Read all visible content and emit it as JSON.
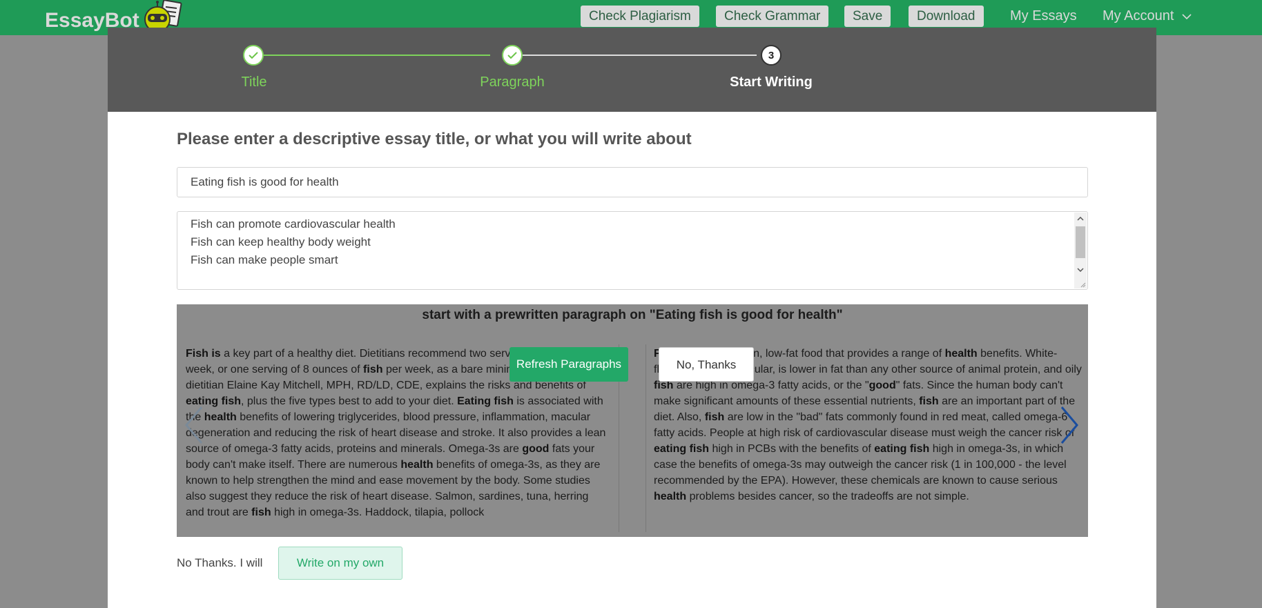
{
  "topbar": {
    "logo_text": "EssayBot",
    "buttons": [
      "Check Plagiarism",
      "Check Grammar",
      "Save",
      "Download"
    ],
    "links": [
      "My Essays",
      "My Account"
    ]
  },
  "stepper": {
    "steps": [
      {
        "label": "Title",
        "state": "done"
      },
      {
        "label": "Paragraph",
        "state": "done"
      },
      {
        "label": "Start Writing",
        "state": "active",
        "number": "3"
      }
    ]
  },
  "form": {
    "heading": "Please enter a descriptive essay title, or what you will write about",
    "title_value": "Eating fish is good for health",
    "outline_lines": [
      "Fish can promote cardiovascular health",
      "Fish can keep healthy body weight",
      "Fish can make people smart"
    ]
  },
  "prewritten": {
    "header": "start with a prewritten paragraph on \"Eating fish is good for health\"",
    "refresh_label": "Refresh Paragraphs",
    "no_thanks_label": "No, Thanks"
  },
  "write_own": {
    "label": "No Thanks. I will",
    "button": "Write on my own"
  },
  "colors": {
    "topbar": "#1f9b57",
    "accent_green": "#23a868",
    "step_done": "#7ed35b",
    "stepper_bg": "#595959"
  },
  "icons": [
    "check-icon",
    "chevron-down-icon",
    "chevron-left-icon",
    "chevron-right-icon",
    "scroll-up-icon",
    "scroll-down-icon",
    "resize-grip-icon",
    "robot-mascot-icon"
  ]
}
